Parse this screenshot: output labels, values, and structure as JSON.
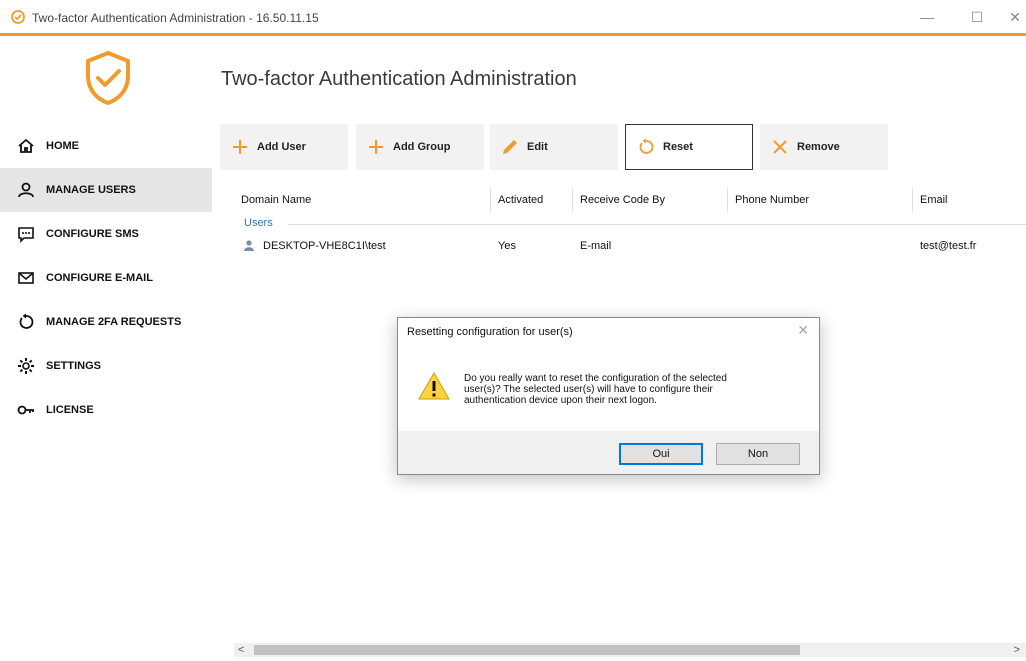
{
  "window": {
    "title": "Two-factor Authentication Administration - 16.50.11.15",
    "minimize": "—",
    "maximize": "☐",
    "close": "✕"
  },
  "colors": {
    "accent": "#f39a2d",
    "link": "#3b6fb6",
    "primary_border": "#0078d7"
  },
  "sidebar": {
    "items": [
      {
        "label": "HOME",
        "icon": "home-icon"
      },
      {
        "label": "MANAGE USERS",
        "icon": "user-icon",
        "active": true
      },
      {
        "label": "CONFIGURE SMS",
        "icon": "sms-icon"
      },
      {
        "label": "CONFIGURE E-MAIL",
        "icon": "mail-icon"
      },
      {
        "label": "MANAGE 2FA REQUESTS",
        "icon": "reset-icon"
      },
      {
        "label": "SETTINGS",
        "icon": "gear-icon"
      },
      {
        "label": "LICENSE",
        "icon": "key-icon"
      }
    ]
  },
  "main": {
    "title": "Two-factor Authentication Administration"
  },
  "toolbar": {
    "add_user": "Add User",
    "add_group": "Add Group",
    "edit": "Edit",
    "reset": "Reset",
    "remove": "Remove"
  },
  "table": {
    "columns": [
      "Domain Name",
      "Activated",
      "Receive Code By",
      "Phone Number",
      "Email"
    ],
    "group": "Users",
    "rows": [
      {
        "domain": "DESKTOP-VHE8C1I\\test",
        "activated": "Yes",
        "receive_by": "E-mail",
        "phone": "",
        "email": "test@test.fr"
      }
    ]
  },
  "scrollbar": {
    "left": "<",
    "right": ">"
  },
  "dialog": {
    "title": "Resetting configuration for user(s)",
    "close": "✕",
    "message_line1": "Do you really want to reset the configuration of the selected",
    "message_line2": "user(s)? The selected user(s) will have to configure their",
    "message_line3": "authentication device upon their next logon.",
    "yes": "Oui",
    "no": "Non"
  }
}
